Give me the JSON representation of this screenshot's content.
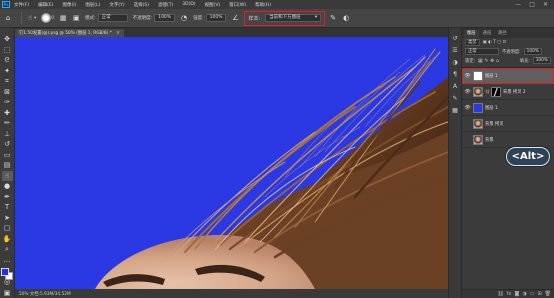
{
  "menubar": {
    "logo": "Ps",
    "items": [
      "文件(F)",
      "编辑(E)",
      "图像(I)",
      "图层(L)",
      "文字(Y)",
      "选择(S)",
      "滤镜(T)",
      "3D(D)",
      "视图(V)",
      "窗口(W)",
      "帮助(H)"
    ],
    "controls": [
      "—",
      "□",
      "✕"
    ]
  },
  "options": {
    "mode_label": "模式:",
    "mode_value": "正常",
    "opacity_label": "不透明度:",
    "opacity_value": "100%",
    "strength_label": "强度:",
    "strength_value": "100%",
    "sample_label": "样本:",
    "sample_value": "当前和下方图层",
    "size_value": "0"
  },
  "document": {
    "tab_title": "钉1.50发置(@).psg @ 50% (图层 1, RGB/8) *",
    "status": "50%   文档:5.93M/34.52M"
  },
  "layers_panel": {
    "tabs": [
      "图层",
      "通道",
      "路径"
    ],
    "kind_label": "类型",
    "blend_value": "正常",
    "opacity_label": "不透明度:",
    "opacity_value": "100%",
    "lock_label": "锁定:",
    "fill_label": "填充:",
    "fill_value": "100%",
    "layers": [
      {
        "name": "图层 1",
        "thumb": "white",
        "selected": true,
        "visible": true
      },
      {
        "name": "背景 拷贝 2",
        "thumb": "mask",
        "selected": false,
        "visible": true
      },
      {
        "name": "图层 1",
        "thumb": "blue",
        "selected": false,
        "visible": true
      },
      {
        "name": "背景 拷贝",
        "thumb": "photo",
        "selected": false,
        "visible": false
      },
      {
        "name": "背景",
        "thumb": "photo",
        "selected": false,
        "visible": false
      }
    ]
  },
  "overlay": {
    "key_badge": "<Alt>"
  },
  "colors": {
    "canvas_blue": "#2b39e4",
    "highlight_red": "#e02020",
    "foreground": "#1e32e8",
    "background": "#ffffff"
  }
}
